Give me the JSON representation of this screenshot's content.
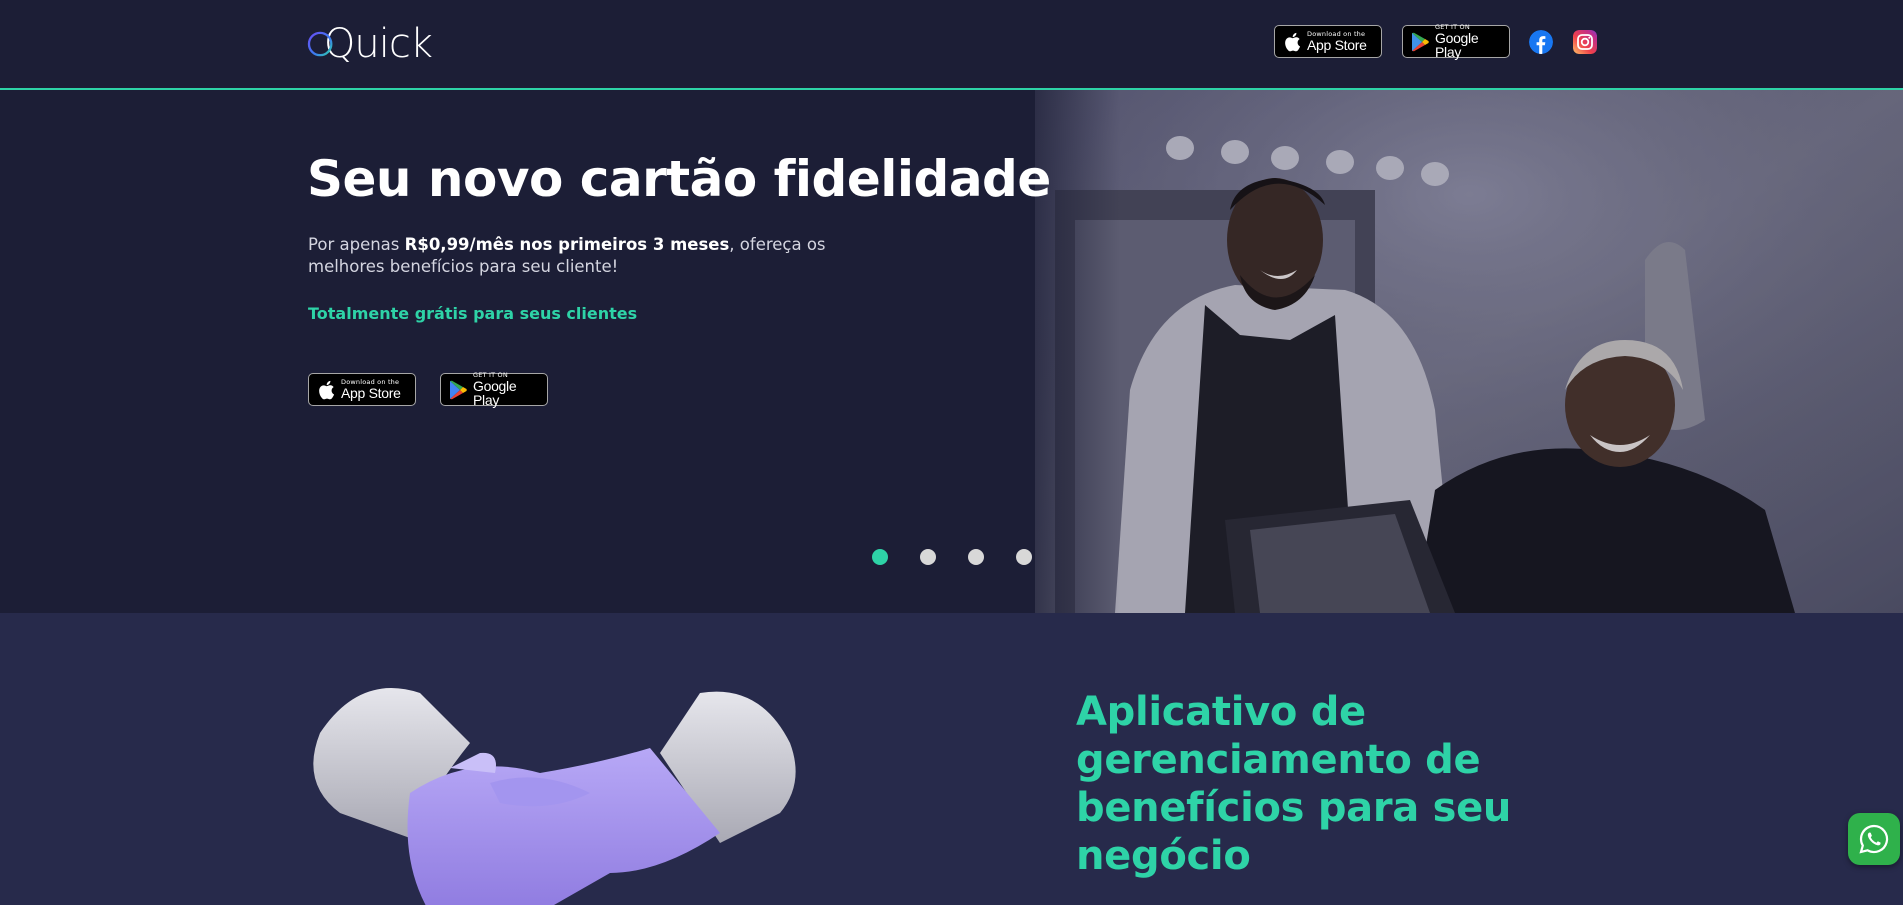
{
  "header": {
    "logo_text": "Quick",
    "app_store": {
      "small": "Download on the",
      "big": "App Store"
    },
    "google_play": {
      "small": "GET IT ON",
      "big": "Google Play"
    },
    "social": [
      "facebook-icon",
      "instagram-icon"
    ]
  },
  "hero": {
    "title": "Seu novo cartão fidelidade",
    "desc_prefix": "Por apenas ",
    "desc_bold": "R$0,99/mês nos primeiros 3 meses",
    "desc_suffix": ", ofereça os melhores benefícios para seu cliente!",
    "free_text": "Totalmente grátis para seus clientes",
    "app_store": {
      "small": "Download on the",
      "big": "App Store"
    },
    "google_play": {
      "small": "GET IT ON",
      "big": "Google Play"
    },
    "slides": 4,
    "active_slide": 1
  },
  "section2": {
    "title": "Aplicativo de gerenciamento de benefícios para seu negócio"
  },
  "colors": {
    "accent": "#2ed3a7",
    "header_bg": "#1c1e36",
    "section_bg": "#272a4b",
    "whatsapp": "#2fb14b"
  }
}
